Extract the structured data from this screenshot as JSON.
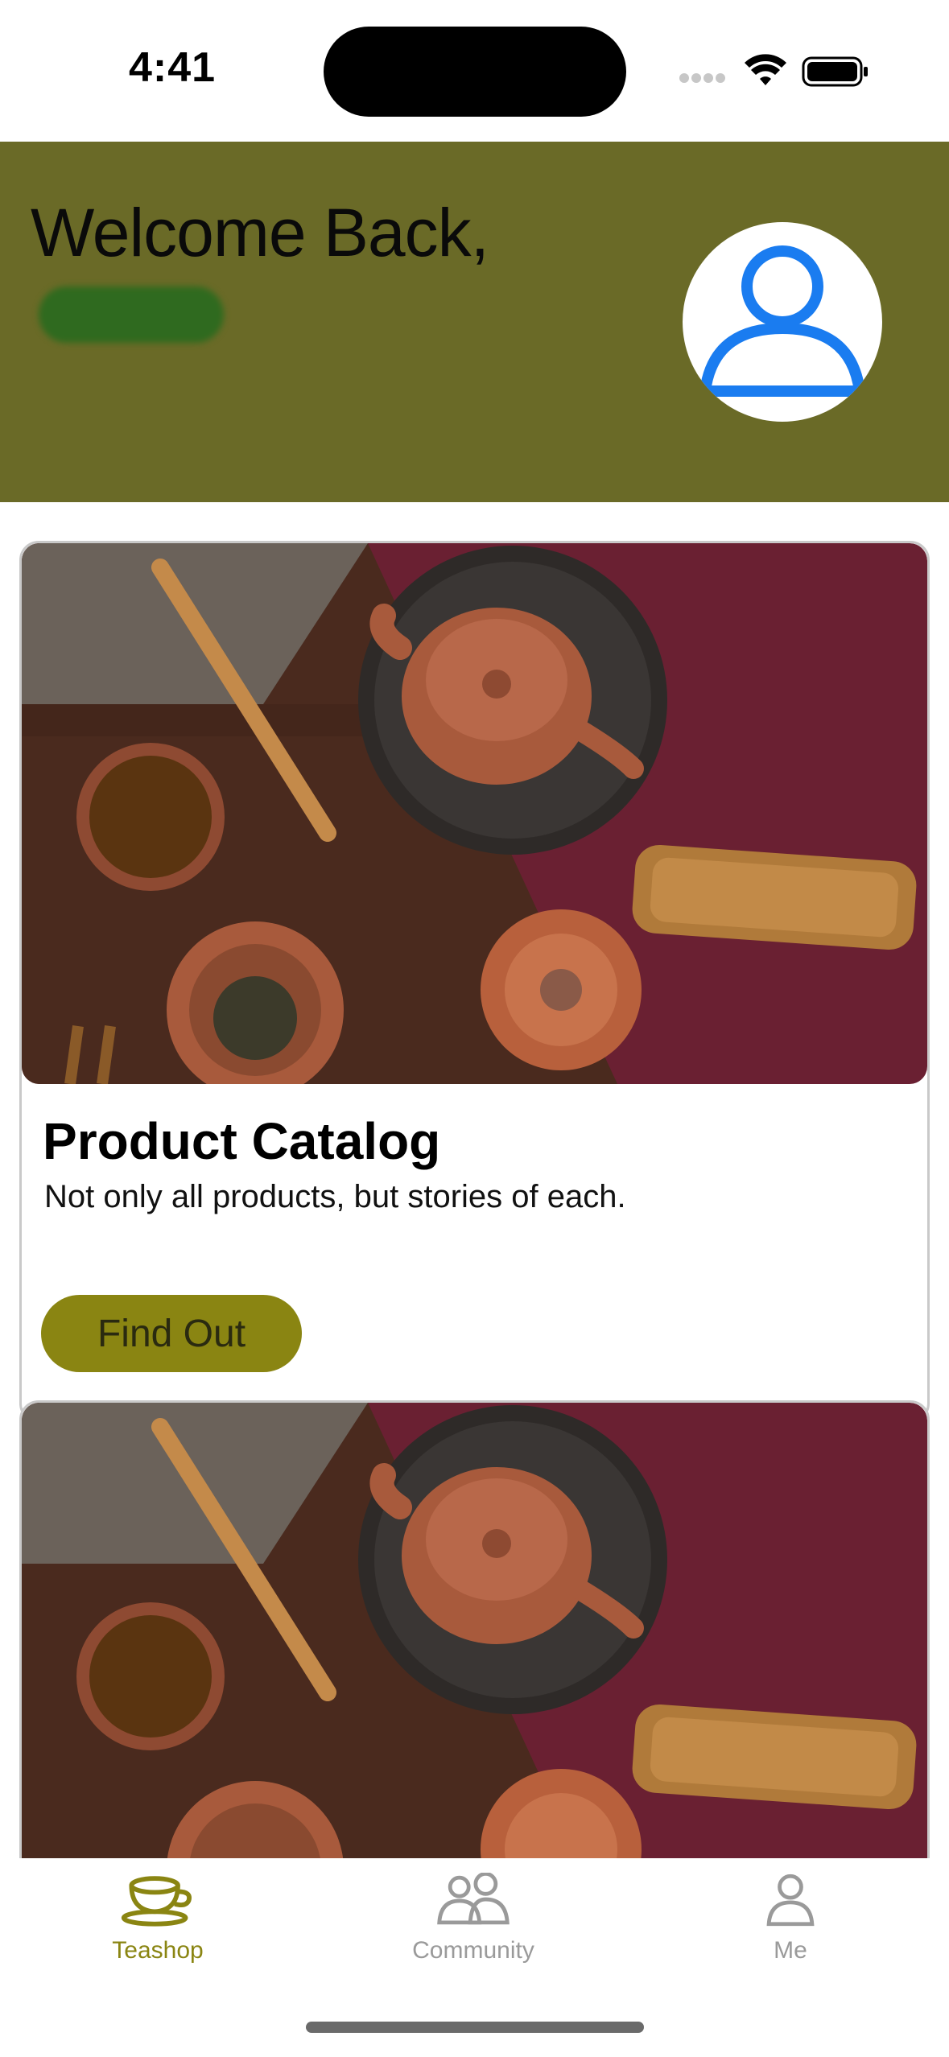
{
  "status_bar": {
    "time": "4:41"
  },
  "header": {
    "welcome_text": "Welcome Back,",
    "background_color": "#6a6a27",
    "avatar_icon": "person-icon",
    "avatar_color": "#1a7cf0"
  },
  "cards": [
    {
      "title": "Product Catalog",
      "description": "Not only all products, but stories of each.",
      "button_label": "Find Out",
      "image": "tea-set-photo"
    },
    {
      "image": "tea-set-photo"
    }
  ],
  "tab_bar": {
    "items": [
      {
        "label": "Teashop",
        "icon": "teacup-icon",
        "selected": true
      },
      {
        "label": "Community",
        "icon": "people-icon",
        "selected": false
      },
      {
        "label": "Me",
        "icon": "person-icon",
        "selected": false
      }
    ],
    "accent_color": "#8a8512",
    "inactive_color": "#9a9a9a"
  }
}
